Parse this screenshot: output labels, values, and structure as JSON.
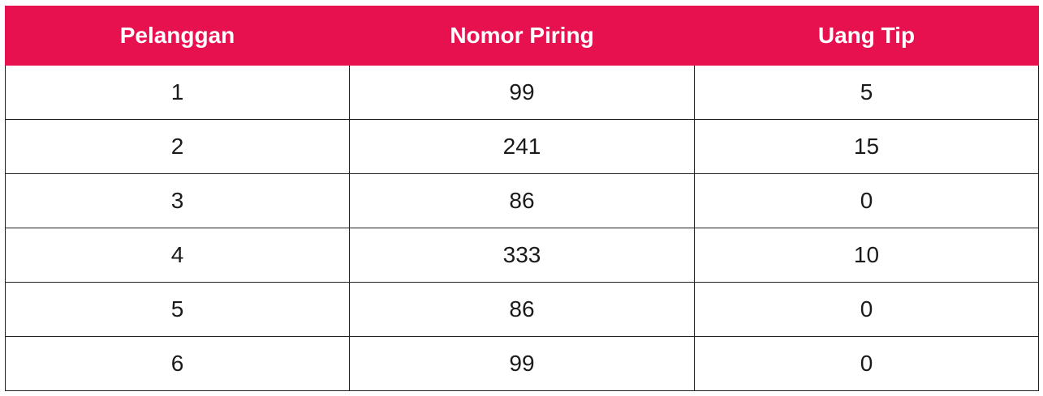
{
  "table": {
    "headers": [
      "Pelanggan",
      "Nomor Piring",
      "Uang Tip"
    ],
    "rows": [
      [
        "1",
        "99",
        "5"
      ],
      [
        "2",
        "241",
        "15"
      ],
      [
        "3",
        "86",
        "0"
      ],
      [
        "4",
        "333",
        "10"
      ],
      [
        "5",
        "86",
        "0"
      ],
      [
        "6",
        "99",
        "0"
      ]
    ],
    "header_color": "#e8114f"
  }
}
